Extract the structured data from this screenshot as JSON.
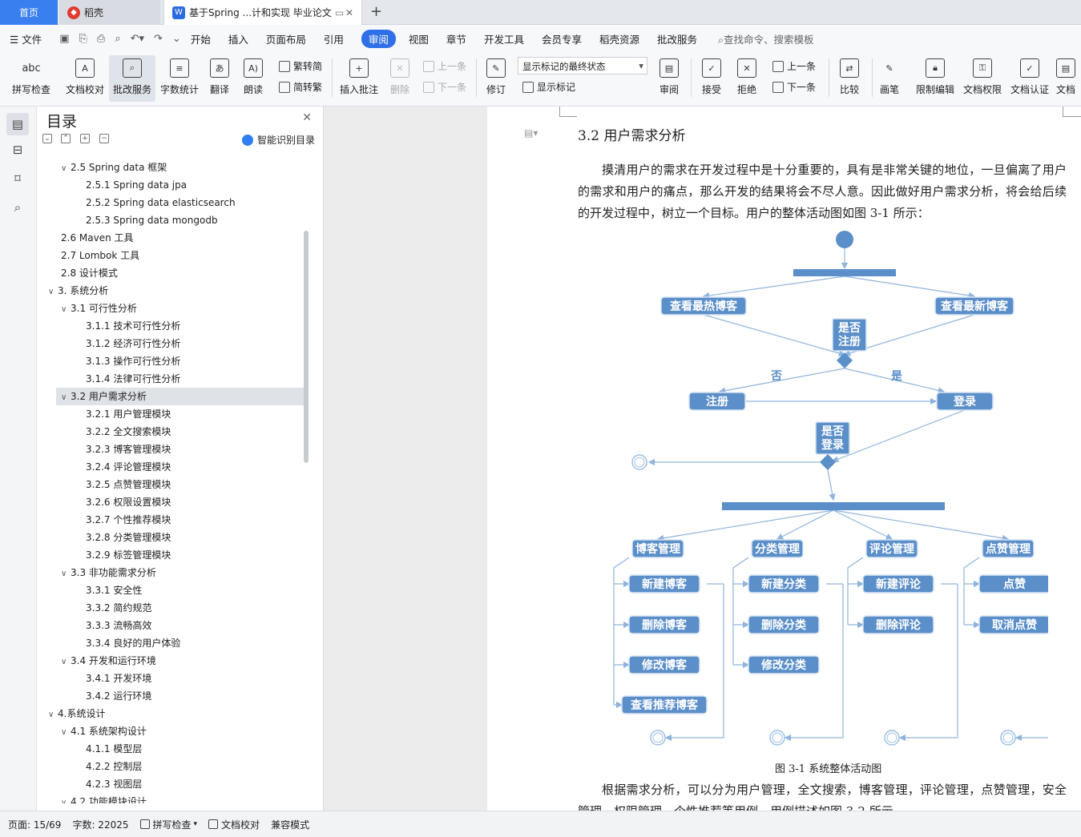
{
  "tabs": {
    "home": "首页",
    "daoke": "稻壳",
    "doc": "基于Spring ...计和实现 毕业论文",
    "add": "+"
  },
  "menu": {
    "file": "文件",
    "items": [
      "开始",
      "插入",
      "页面布局",
      "引用",
      "审阅",
      "视图",
      "章节",
      "开发工具",
      "会员专享",
      "稻壳资源",
      "批改服务"
    ],
    "active": "审阅",
    "search": "查找命令、搜索模板"
  },
  "ribbon": {
    "spell": "拼写检查",
    "proof": "文档校对",
    "review_service": "批改服务",
    "word_count": "字数统计",
    "translate": "翻译",
    "read": "朗读",
    "trad": "繁转简",
    "simp": "简转繁",
    "insert_comment": "插入批注",
    "delete": "删除",
    "prev": "上一条",
    "next": "下一条",
    "revise": "修订",
    "markup_state": "显示标记的最终状态",
    "show_markup": "显示标记",
    "review": "审阅",
    "accept": "接受",
    "reject": "拒绝",
    "prev2": "上一条",
    "next2": "下一条",
    "compare": "比较",
    "pen": "画笔",
    "restrict": "限制编辑",
    "permission": "文档权限",
    "certify": "文档认证",
    "doc_more": "文档"
  },
  "toc": {
    "title": "目录",
    "smart": "智能识别目录",
    "items": [
      {
        "label": "2.5 Spring data  框架",
        "level": 2,
        "toggle": "v"
      },
      {
        "label": "2.5.1 Spring data jpa",
        "level": 3,
        "toggle": ""
      },
      {
        "label": "2.5.2 Spring data elasticsearch",
        "level": 3,
        "toggle": ""
      },
      {
        "label": "2.5.3 Spring data mongodb",
        "level": 3,
        "toggle": ""
      },
      {
        "label": "2.6 Maven  工具",
        "level": 2,
        "toggle": ""
      },
      {
        "label": "2.7 Lombok  工具",
        "level": 2,
        "toggle": ""
      },
      {
        "label": "2.8  设计模式",
        "level": 2,
        "toggle": ""
      },
      {
        "label": "3.  系统分析",
        "level": 1,
        "toggle": "v"
      },
      {
        "label": "3.1  可行性分析",
        "level": 2,
        "toggle": "v"
      },
      {
        "label": "3.1.1  技术可行性分析",
        "level": 3,
        "toggle": ""
      },
      {
        "label": "3.1.2  经济可行性分析",
        "level": 3,
        "toggle": ""
      },
      {
        "label": "3.1.3  操作可行性分析",
        "level": 3,
        "toggle": ""
      },
      {
        "label": "3.1.4  法律可行性分析",
        "level": 3,
        "toggle": ""
      },
      {
        "label": "3.2  用户需求分析",
        "level": 2,
        "toggle": "v",
        "selected": true
      },
      {
        "label": "3.2.1  用户管理模块",
        "level": 3,
        "toggle": ""
      },
      {
        "label": "3.2.2  全文搜索模块",
        "level": 3,
        "toggle": ""
      },
      {
        "label": "3.2.3  博客管理模块",
        "level": 3,
        "toggle": ""
      },
      {
        "label": "3.2.4  评论管理模块",
        "level": 3,
        "toggle": ""
      },
      {
        "label": "3.2.5  点赞管理模块",
        "level": 3,
        "toggle": ""
      },
      {
        "label": "3.2.6  权限设置模块",
        "level": 3,
        "toggle": ""
      },
      {
        "label": "3.2.7  个性推荐模块",
        "level": 3,
        "toggle": ""
      },
      {
        "label": "3.2.8 分类管理模块",
        "level": 3,
        "toggle": ""
      },
      {
        "label": "3.2.9 标签管理模块",
        "level": 3,
        "toggle": ""
      },
      {
        "label": "3.3  非功能需求分析",
        "level": 2,
        "toggle": "v"
      },
      {
        "label": "3.3.1 安全性",
        "level": 3,
        "toggle": ""
      },
      {
        "label": "3.3.2 简约规范",
        "level": 3,
        "toggle": ""
      },
      {
        "label": "3.3.3 流畅高效",
        "level": 3,
        "toggle": ""
      },
      {
        "label": "3.3.4 良好的用户体验",
        "level": 3,
        "toggle": ""
      },
      {
        "label": "3.4  开发和运行环境",
        "level": 2,
        "toggle": "v"
      },
      {
        "label": "3.4.1  开发环境",
        "level": 3,
        "toggle": ""
      },
      {
        "label": "3.4.2  运行环境",
        "level": 3,
        "toggle": ""
      },
      {
        "label": "4.系统设计",
        "level": 1,
        "toggle": "v"
      },
      {
        "label": "4.1  系统架构设计",
        "level": 2,
        "toggle": "v"
      },
      {
        "label": "4.1.1 模型层",
        "level": 3,
        "toggle": ""
      },
      {
        "label": "4.2.2 控制层",
        "level": 3,
        "toggle": ""
      },
      {
        "label": "4.2.3 视图层",
        "level": 3,
        "toggle": ""
      },
      {
        "label": "4.2  功能模块设计",
        "level": 2,
        "toggle": "v"
      }
    ]
  },
  "doc": {
    "heading": "3.2  用户需求分析",
    "para1": "摸清用户的需求在开发过程中是十分重要的，具有是非常关键的地位，一旦偏离了用户的需求和用户的痛点，那么开发的结果将会不尽人意。因此做好用户需求分析，将会给后续的开发过程中，树立一个目标。用户的整体活动图如图 3-1 所示：",
    "caption": "图 3-1  系统整体活动图",
    "para2": "根据需求分析，可以分为用户管理，全文搜索，博客管理，评论管理，点赞管理，安全管理，权限管理，个性推荐等用例，用例描述如图 3-2 所示。"
  },
  "diagram": {
    "hot": "查看最热博客",
    "latest": "查看最新博客",
    "is_registered": [
      "是否",
      "注册"
    ],
    "no": "否",
    "yes": "是",
    "register": "注册",
    "login": "登录",
    "is_logged": [
      "是否",
      "登录"
    ],
    "groups": [
      {
        "title": "博客管理",
        "items": [
          "新建博客",
          "删除博客",
          "修改博客",
          "查看推荐博客"
        ]
      },
      {
        "title": "分类管理",
        "items": [
          "新建分类",
          "删除分类",
          "修改分类"
        ]
      },
      {
        "title": "评论管理",
        "items": [
          "新建评论",
          "删除评论"
        ]
      },
      {
        "title": "点赞管理",
        "items": [
          "点赞",
          "取消点赞"
        ]
      }
    ],
    "colors": {
      "node": "#5b8fc9",
      "edge": "#8fb3dc"
    }
  },
  "status": {
    "page": "页面: 15/69",
    "words": "字数: 22025",
    "spell": "拼写检查",
    "proof": "文档校对",
    "compat": "兼容模式"
  }
}
